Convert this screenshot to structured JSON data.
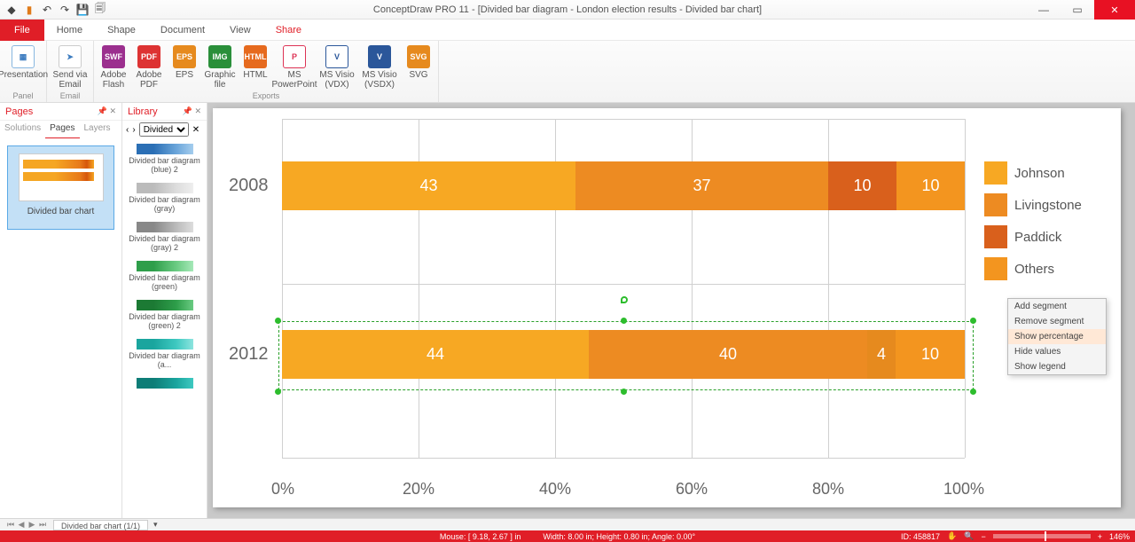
{
  "app": {
    "title": "ConceptDraw PRO 11 - [Divided bar diagram - London election results - Divided bar chart]"
  },
  "tabs": {
    "file": "File",
    "items": [
      "Home",
      "Shape",
      "Document",
      "View",
      "Share"
    ],
    "active": "Share"
  },
  "ribbon": {
    "presentation": "Presentation",
    "send_email": "Send via Email",
    "adobe_flash": "Adobe Flash",
    "adobe_pdf": "Adobe PDF",
    "eps": "EPS",
    "graphic": "Graphic file",
    "html": "HTML",
    "ppt": "MS PowerPoint",
    "visio_vdx": "MS Visio (VDX)",
    "visio_vsdx": "MS Visio (VSDX)",
    "svg": "SVG",
    "grp_panel": "Panel",
    "grp_email": "Email",
    "grp_exports": "Exports"
  },
  "pages": {
    "title": "Pages",
    "subtabs": [
      "Solutions",
      "Pages",
      "Layers"
    ],
    "thumb": "Divided bar chart"
  },
  "library": {
    "title": "Library",
    "dropdown": "Divided ...",
    "items": [
      "Divided bar diagram (blue) 2",
      "Divided bar diagram (gray)",
      "Divided bar diagram (gray) 2",
      "Divided bar diagram (green)",
      "Divided bar diagram (green) 2",
      "Divided bar diagram (a...",
      ""
    ]
  },
  "chart_data": {
    "type": "bar",
    "orientation": "horizontal-stacked",
    "title": "London election results",
    "xlabel": "",
    "ylabel": "",
    "categories": [
      "2008",
      "2012"
    ],
    "x_ticks": [
      "0%",
      "20%",
      "40%",
      "60%",
      "80%",
      "100%"
    ],
    "series": [
      {
        "name": "Johnson",
        "color": "#f7a823",
        "values": [
          43,
          44
        ]
      },
      {
        "name": "Livingstone",
        "color": "#ed8b22",
        "values": [
          37,
          40
        ]
      },
      {
        "name": "Paddick",
        "color": "#d9601c",
        "values": [
          10,
          4
        ]
      },
      {
        "name": "Others",
        "color": "#ec8222",
        "values": [
          10,
          10
        ]
      }
    ],
    "selected_row": 1
  },
  "context_menu": {
    "items": [
      "Add segment",
      "Remove segment",
      "Show percentage",
      "Hide values",
      "Show legend"
    ],
    "highlight": 2
  },
  "sheet": {
    "tab": "Divided bar chart (1/1)"
  },
  "status": {
    "mouse": "Mouse: [ 9.18, 2.67 ] in",
    "dims": "Width: 8.00 in;  Height: 0.80 in;  Angle: 0.00°",
    "id": "ID: 458817",
    "zoom": "146%"
  }
}
